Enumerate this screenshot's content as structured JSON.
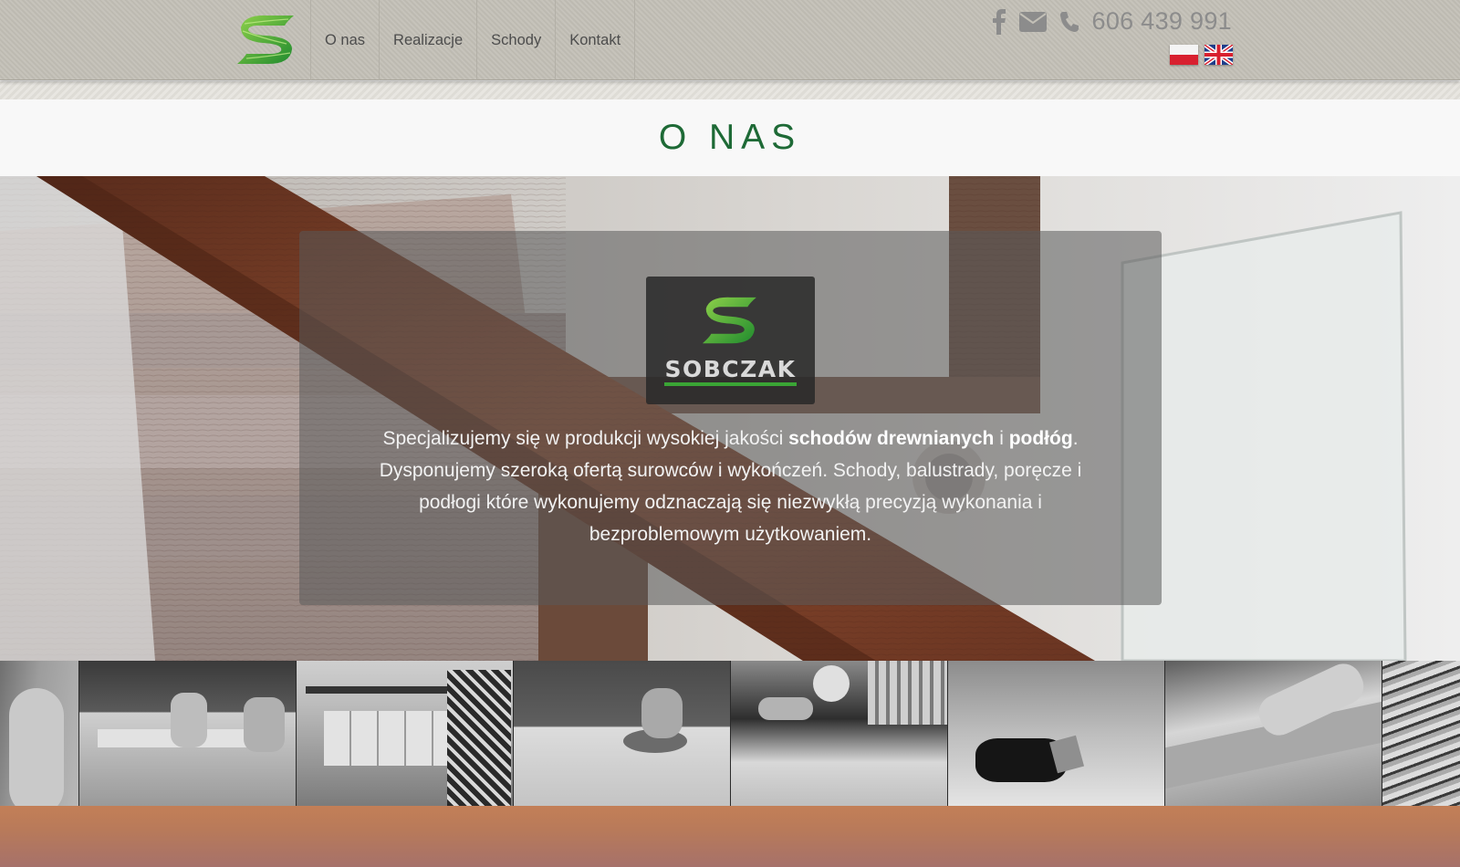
{
  "header": {
    "nav": [
      "O nas",
      "Realizacje",
      "Schody",
      "Kontakt"
    ],
    "phone": "606 439 991",
    "contact_icons": [
      "facebook-icon",
      "envelope-icon",
      "phone-icon"
    ],
    "languages": [
      "Polski",
      "English"
    ]
  },
  "title": "O NAS",
  "about": {
    "brand": "SOBCZAK",
    "p1": "Specjalizujemy się w produkcji wysokiej jakości ",
    "b1": "schodów drewnianych",
    "p2": " i ",
    "b2": "podłóg",
    "p3": ". Dysponujemy szeroką ofertą surowców i wykończeń. Schody, balustrady, poręcze i podłogi które wykonujemy odznaczają się niezwykłą precyzją wykonania i bezproblemowym użytkowaniem."
  },
  "colors": {
    "brand_green": "#1e6a36",
    "logo_green": "#5cb82e",
    "header_bg": "#c3c0b7"
  }
}
